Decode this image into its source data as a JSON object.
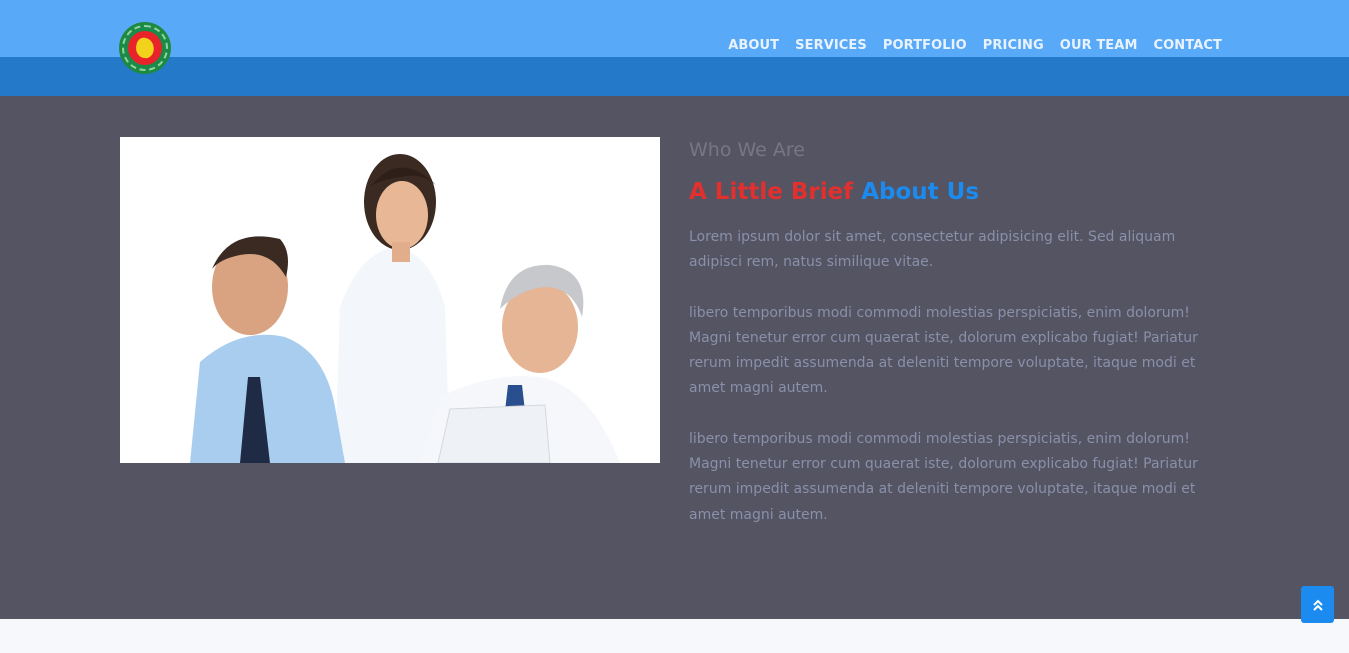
{
  "header": {
    "logo_name": "bangladesh-emblem-logo",
    "nav": [
      {
        "label": "ABOUT"
      },
      {
        "label": "SERVICES"
      },
      {
        "label": "PORTFOLIO"
      },
      {
        "label": "PRICING"
      },
      {
        "label": "OUR TEAM"
      },
      {
        "label": "CONTACT"
      }
    ]
  },
  "about": {
    "eyebrow": "Who We Are",
    "heading_red": "A Little Brief",
    "heading_blue": "About Us",
    "paragraphs": [
      "Lorem ipsum dolor sit amet, consectetur adipisicing elit. Sed aliquam adipisci rem, natus similique vitae.",
      "libero temporibus modi commodi molestias perspiciatis, enim dolorum! Magni tenetur error cum quaerat iste, dolorum explicabo fugiat! Pariatur rerum impedit assumenda at deleniti tempore voluptate, itaque modi et amet magni autem.",
      "libero temporibus modi commodi molestias perspiciatis, enim dolorum! Magni tenetur error cum quaerat iste, dolorum explicabo fugiat! Pariatur rerum impedit assumenda at deleniti tempore voluptate, itaque modi et amet magni autem."
    ]
  },
  "colors": {
    "topbar_light": "#58a9f7",
    "topbar_dark": "#2479c9",
    "section_bg": "#545463",
    "accent_red": "#e2302e",
    "accent_blue": "#1c8bf0"
  },
  "icons": {
    "scroll_top": "double-chevron-up-icon"
  }
}
